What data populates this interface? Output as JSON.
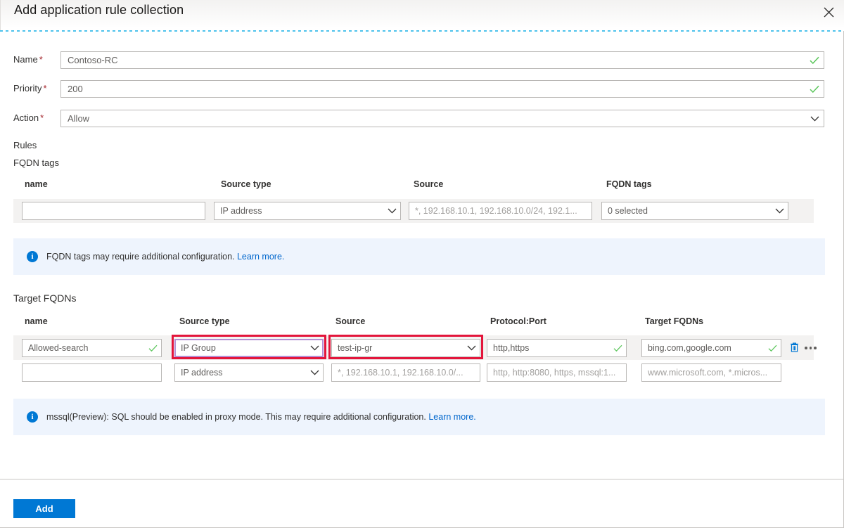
{
  "blade": {
    "title": "Add application rule collection",
    "close_icon": "close-icon"
  },
  "form": {
    "fields": [
      {
        "label": "Name",
        "required": "*",
        "value": "Contoso-RC",
        "adorn": "valid-check-icon"
      },
      {
        "label": "Priority",
        "required": "*",
        "value": "200",
        "adorn": "valid-check-icon"
      },
      {
        "label": "Action",
        "required": "*",
        "value": "Allow",
        "adorn": "chevron-down-icon"
      }
    ]
  },
  "rules": {
    "heading": "Rules",
    "fqdn_tags": {
      "heading": "FQDN tags",
      "columns": [
        "name",
        "Source type",
        "Source",
        "FQDN tags"
      ],
      "rows": [
        {
          "name": "",
          "name_placeholder": "",
          "source_type": "IP address",
          "source": "",
          "source_placeholder": "*, 192.168.10.1, 192.168.10.0/24, 192.1...",
          "fqdn_tags": "0 selected"
        }
      ]
    },
    "fqdn_tags_banner": {
      "text": "FQDN tags may require additional configuration.",
      "link": "Learn more."
    },
    "target_fqdns": {
      "heading": "Target FQDNs",
      "columns": [
        "name",
        "Source type",
        "Source",
        "Protocol:Port",
        "Target FQDNs"
      ],
      "rows": [
        {
          "name": "Allowed-search",
          "source_type": "IP Group",
          "source": "test-ip-gr",
          "protocol_port": "http,https",
          "target_fqdns": "bing.com,google.com",
          "filled": true
        },
        {
          "name": "",
          "name_placeholder": "",
          "source_type": "IP address",
          "source_placeholder": "*, 192.168.10.1, 192.168.10.0/...",
          "protocol_port_placeholder": "http, http:8080, https, mssql:1...",
          "target_fqdns_placeholder": "www.microsoft.com, *.micros...",
          "filled": false
        }
      ]
    },
    "mssql_banner": {
      "text": "mssql(Preview): SQL should be enabled in proxy mode. This may require additional configuration.",
      "link": "Learn more."
    }
  },
  "row_actions": {
    "delete_icon": "trash-icon",
    "more_icon": "ellipsis-icon"
  },
  "footer": {
    "add_label": "Add"
  },
  "colors": {
    "accent": "#0078d4",
    "highlight": "#e3153b",
    "valid": "#5ec75e",
    "required": "#a4262c",
    "banner_bg": "#eef4fd",
    "row_band": "#f3f2f1",
    "focus_border": "#b48fd4"
  }
}
